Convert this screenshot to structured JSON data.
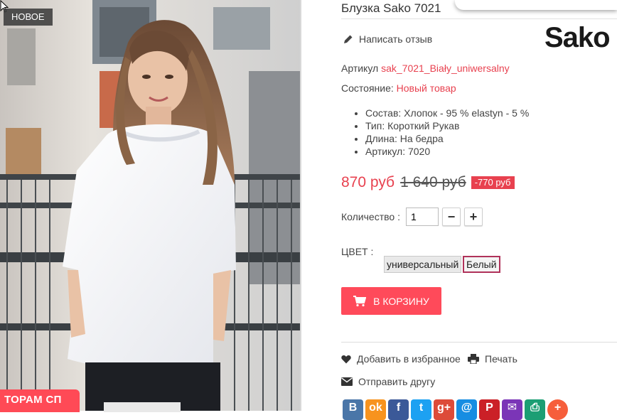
{
  "badge": {
    "new_label": "НОВОЕ"
  },
  "promo": {
    "label": "ТОРАМ СП"
  },
  "product": {
    "title": "Блузка Sako 7021",
    "review_label": "Написать отзыв",
    "brand_logo": "Sako",
    "article_label": "Артикул",
    "article_value": "sak_7021_Biały_uniwersalny",
    "condition_label": "Состояние:",
    "condition_value": "Новый товар",
    "features": [
      "Состав: Хлопок - 95 % elastyn - 5 %",
      "Тип: Короткий Рукав",
      "Длина: На бедра",
      "Артикул:  7020"
    ]
  },
  "price": {
    "current": "870 руб",
    "old": "1 640 руб",
    "discount": "-770 руб"
  },
  "quantity": {
    "label": "Количество :",
    "value": "1",
    "minus": "−",
    "plus": "+"
  },
  "color": {
    "label": "ЦВЕТ :",
    "options": [
      "универсальный",
      "Белый"
    ],
    "selected": "Белый"
  },
  "cart": {
    "label": "В КОРЗИНУ"
  },
  "actions": {
    "favorite": "Добавить в избранное",
    "print": "Печать",
    "send": "Отправить другу"
  },
  "social": [
    {
      "icon": "vk-icon",
      "glyph": "В",
      "color": "#4a76a8"
    },
    {
      "icon": "odnoklassniki-icon",
      "glyph": "ok",
      "color": "#f7931e"
    },
    {
      "icon": "facebook-icon",
      "glyph": "f",
      "color": "#3b5998"
    },
    {
      "icon": "twitter-icon",
      "glyph": "t",
      "color": "#1da1f2"
    },
    {
      "icon": "google-plus-icon",
      "glyph": "g+",
      "color": "#dd4b39"
    },
    {
      "icon": "mailru-icon",
      "glyph": "@",
      "color": "#168de2"
    },
    {
      "icon": "pinterest-icon",
      "glyph": "P",
      "color": "#cb2027"
    },
    {
      "icon": "email-icon",
      "glyph": "✉",
      "color": "#7b35b7"
    },
    {
      "icon": "print-share-icon",
      "glyph": "⎙",
      "color": "#1c9e74"
    },
    {
      "icon": "more-share-icon",
      "glyph": "+",
      "color": "#f65e3b"
    }
  ],
  "colors": {
    "accent": "#e8414f",
    "button": "#ff4a5a",
    "selected_border": "#b0325a"
  }
}
